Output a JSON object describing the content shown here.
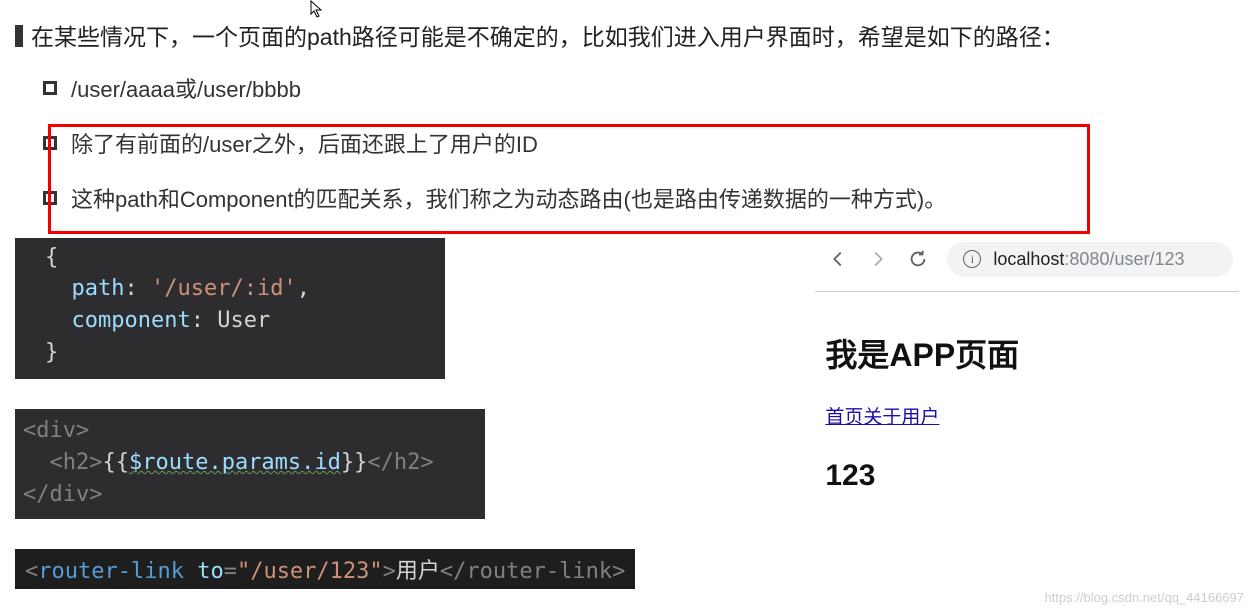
{
  "bullets": {
    "main": "在某些情况下，一个页面的path路径可能是不确定的，比如我们进入用户界面时，希望是如下的路径：",
    "sub1": "/user/aaaa或/user/bbbb",
    "sub2": "除了有前面的/user之外，后面还跟上了用户的ID",
    "sub3": "这种path和Component的匹配关系，我们称之为动态路由(也是路由传递数据的一种方式)。"
  },
  "code1": {
    "open": "{",
    "path_key": "path",
    "path_val": "'/user/:id'",
    "comp_key": "component",
    "comp_val": "User",
    "close": "}"
  },
  "code2": {
    "div_open": "<div>",
    "h2_open": "<h2>",
    "expr_open": "{{",
    "route": "$route.params.id",
    "expr_close": "}}",
    "h2_close": "</h2>",
    "div_close": "</div>"
  },
  "code3": {
    "open_lt": "<",
    "tagname": "router-link",
    "attr": "to",
    "eq": "=",
    "val": "\"/user/123\"",
    "gt": ">",
    "text": "用户",
    "close": "</router-link>"
  },
  "browser": {
    "url_host": "localhost",
    "url_port": ":8080",
    "url_path": "/user/123"
  },
  "page": {
    "title": "我是APP页面",
    "nav_home": "首页",
    "nav_about": "关于",
    "nav_user": "用户",
    "result": "123"
  },
  "watermark": "https://blog.csdn.net/qq_44166697"
}
